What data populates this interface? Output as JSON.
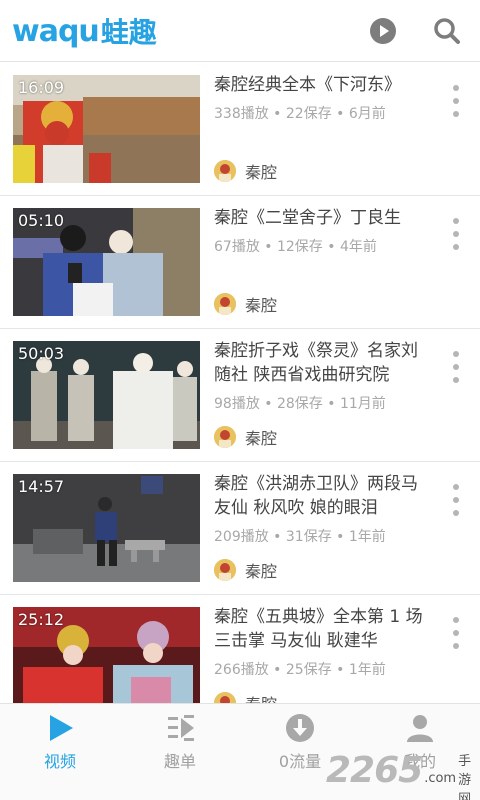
{
  "header": {
    "logo_latin": "waqu",
    "logo_cn": "蛙趣",
    "play_icon": "play-circle-icon",
    "search_icon": "search-icon"
  },
  "videos": [
    {
      "duration": "16:09",
      "title": "秦腔经典全本《下河东》",
      "meta": "338播放 • 22保存 • 6月前",
      "author": "秦腔"
    },
    {
      "duration": "05:10",
      "title": "秦腔《二堂舍子》丁良生",
      "meta": "67播放 • 12保存 • 4年前",
      "author": "秦腔"
    },
    {
      "duration": "50:03",
      "title": "秦腔折子戏《祭灵》名家刘随社 陕西省戏曲研究院",
      "meta": "98播放 • 28保存 • 11月前",
      "author": "秦腔"
    },
    {
      "duration": "14:57",
      "title": "秦腔《洪湖赤卫队》两段马友仙 秋风吹 娘的眼泪",
      "meta": "209播放 • 31保存 • 1年前",
      "author": "秦腔"
    },
    {
      "duration": "25:12",
      "title": "秦腔《五典坡》全本第 1 场三击掌 马友仙 耿建华",
      "meta": "266播放 • 25保存 • 1年前",
      "author": "秦腔"
    }
  ],
  "tabs": [
    {
      "label": "视频",
      "icon": "play-triangle-icon",
      "active": true
    },
    {
      "label": "趣单",
      "icon": "playlist-icon",
      "active": false
    },
    {
      "label": "0流量",
      "icon": "download-circle-icon",
      "active": false
    },
    {
      "label": "我的",
      "icon": "person-icon",
      "active": false
    }
  ],
  "watermark": {
    "number": "2265",
    "dot_com": ".com",
    "text": "手游网"
  },
  "colors": {
    "accent": "#27a3e3",
    "meta_text": "#a8a8a8",
    "inactive_tab": "#a0a0a0"
  }
}
